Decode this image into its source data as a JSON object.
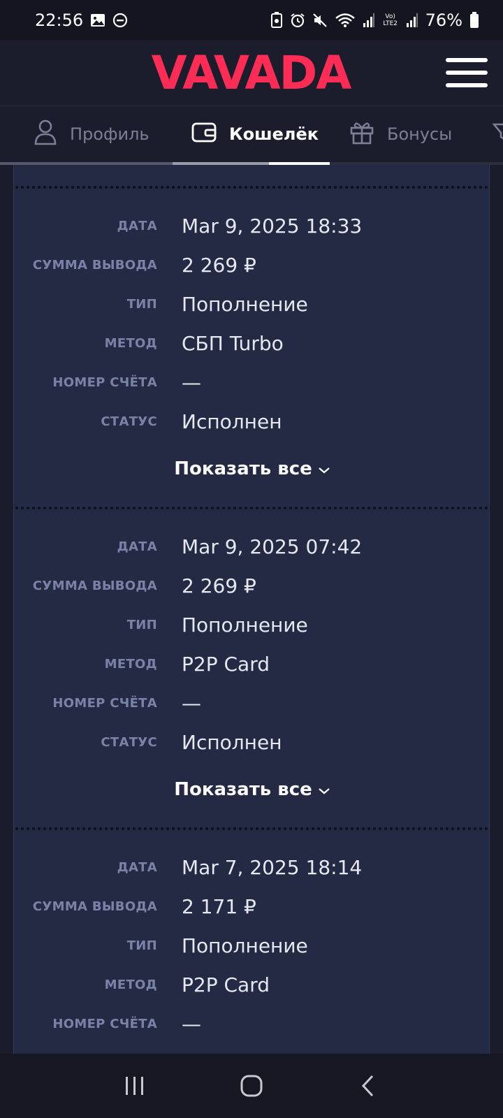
{
  "status_bar": {
    "time": "22:56",
    "battery": "76%",
    "network_label": "Vo) LTE2"
  },
  "header": {
    "logo_text": "VAVADA",
    "brand_color": "#ff2d55"
  },
  "tabs": [
    {
      "label": "Профиль",
      "icon": "user-icon",
      "active": false
    },
    {
      "label": "Кошелёк",
      "icon": "wallet-icon",
      "active": true
    },
    {
      "label": "Бонусы",
      "icon": "gift-icon",
      "active": false
    }
  ],
  "labels": {
    "date": "ДАТА",
    "amount": "СУММА ВЫВОДА",
    "type": "ТИП",
    "method": "МЕТОД",
    "account": "НОМЕР СЧЁТА",
    "status": "СТАТУС"
  },
  "show_all_label": "Показать все",
  "transactions": [
    {
      "date": "Mar 9, 2025 18:33",
      "amount": "2 269 ₽",
      "type": "Пополнение",
      "method": "СБП Turbo",
      "account": "—",
      "status": "Исполнен"
    },
    {
      "date": "Mar 9, 2025 07:42",
      "amount": "2 269 ₽",
      "type": "Пополнение",
      "method": "P2P Card",
      "account": "—",
      "status": "Исполнен"
    },
    {
      "date": "Mar 7, 2025 18:14",
      "amount": "2 171 ₽",
      "type": "Пополнение",
      "method": "P2P Card",
      "account": "—"
    }
  ]
}
